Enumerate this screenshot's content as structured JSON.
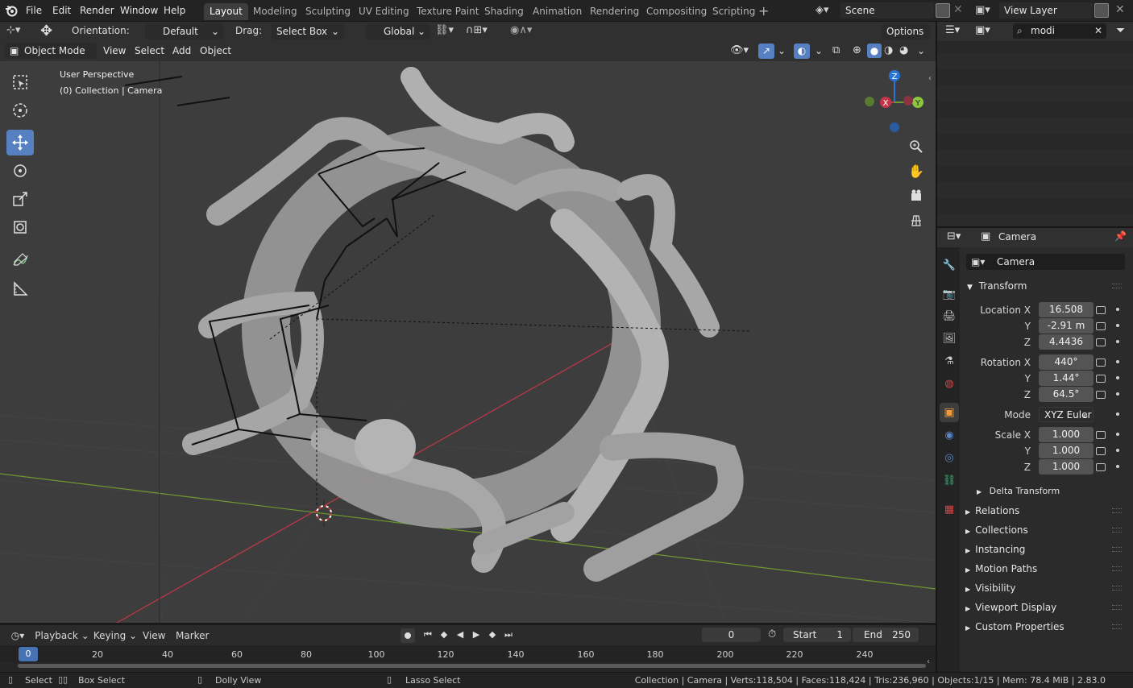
{
  "menu": [
    "File",
    "Edit",
    "Render",
    "Window",
    "Help"
  ],
  "workspaces": [
    "Layout",
    "Modeling",
    "Sculpting",
    "UV Editing",
    "Texture Paint",
    "Shading",
    "Animation",
    "Rendering",
    "Compositing",
    "Scripting"
  ],
  "active_workspace": "Layout",
  "scene_name": "Scene",
  "view_layer": "View Layer",
  "tool_header": {
    "orientation_label": "Orientation:",
    "orientation_value": "Default",
    "drag_label": "Drag:",
    "drag_value": "Select Box",
    "transform_space": "Global",
    "options": "Options"
  },
  "viewport_header": {
    "mode": "Object Mode",
    "view": "View",
    "select": "Select",
    "add": "Add",
    "object": "Object"
  },
  "viewport_overlay": {
    "line1": "User Perspective",
    "line2": "(0) Collection | Camera"
  },
  "gizmo": {
    "x": "X",
    "y": "Y",
    "z": "Z"
  },
  "outliner": {
    "search": "modi"
  },
  "properties": {
    "context": "Camera",
    "object_name": "Camera",
    "transform_header": "Transform",
    "labels": {
      "location_x": "Location X",
      "y": "Y",
      "z": "Z",
      "rotation_x": "Rotation X",
      "mode": "Mode",
      "scale_x": "Scale X"
    },
    "location": [
      "16.508",
      "-2.91 m",
      "4.4436"
    ],
    "rotation": [
      "440°",
      "1.44°",
      "64.5°"
    ],
    "rotation_mode": "XYZ Euler",
    "scale": [
      "1.000",
      "1.000",
      "1.000"
    ],
    "delta_transform": "Delta Transform",
    "panels": [
      "Relations",
      "Collections",
      "Instancing",
      "Motion Paths",
      "Visibility",
      "Viewport Display",
      "Custom Properties"
    ]
  },
  "timeline": {
    "playback": "Playback",
    "keying": "Keying",
    "view": "View",
    "marker": "Marker",
    "current_frame": "0",
    "start_label": "Start",
    "start": "1",
    "end_label": "End",
    "end": "250",
    "ticks": [
      "20",
      "40",
      "60",
      "80",
      "100",
      "120",
      "140",
      "160",
      "180",
      "200",
      "220",
      "240"
    ],
    "playhead": "0"
  },
  "status": {
    "select": "Select",
    "box_select": "Box Select",
    "dolly_view": "Dolly View",
    "lasso_select": "Lasso Select",
    "stats": "Collection | Camera | Verts:118,504 | Faces:118,424 | Tris:236,960 | Objects:1/15 | Mem: 78.4 MiB | 2.83.0"
  },
  "colors": {
    "accent": "#5680c2",
    "x_axis": "#c4374a",
    "y_axis": "#6e9a2f",
    "z_axis": "#2a74d9"
  }
}
